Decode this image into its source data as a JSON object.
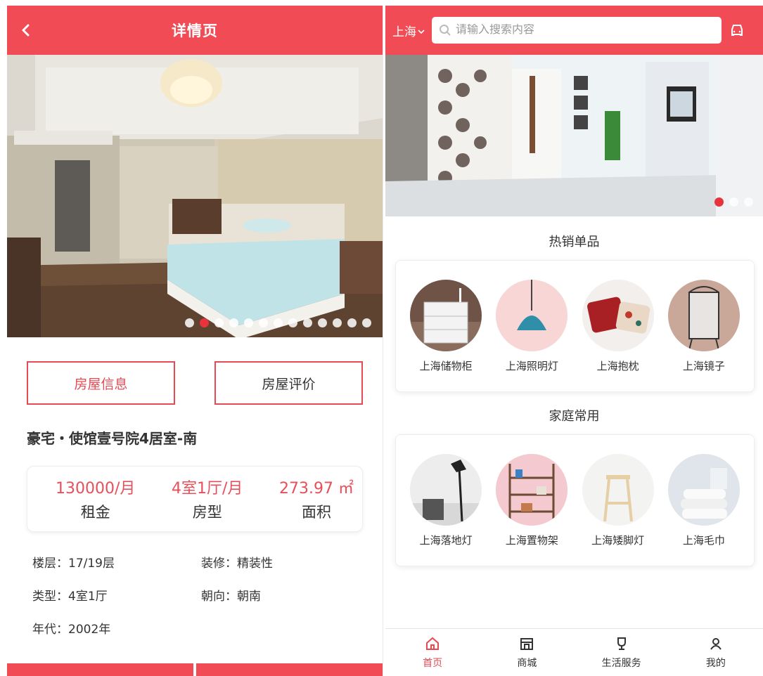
{
  "detail": {
    "header": {
      "title": "详情页"
    },
    "photo": {
      "dot_count": 13,
      "active_dot": 1
    },
    "tabs": [
      {
        "label": "房屋信息",
        "active": true
      },
      {
        "label": "房屋评价",
        "active": false
      }
    ],
    "house_title": "豪宅・使馆壹号院4居室-南",
    "stats": [
      {
        "value": "130000/月",
        "label": "租金"
      },
      {
        "value": "4室1厅/月",
        "label": "房型"
      },
      {
        "value": "273.97 ㎡",
        "label": "面积"
      }
    ],
    "specs": [
      {
        "text": "楼层：17/19层"
      },
      {
        "text": "装修：精装性"
      },
      {
        "text": "类型：4室1厅"
      },
      {
        "text": "朝向：朝南"
      },
      {
        "text": "年代：2002年"
      }
    ]
  },
  "home": {
    "header": {
      "city": "上海",
      "search_placeholder": "请输入搜索内容"
    },
    "banner": {
      "dot_count": 3,
      "active_dot": 0
    },
    "sections": [
      {
        "title": "热销单品",
        "items": [
          {
            "name": "上海储物柜",
            "icon": "dresser-image"
          },
          {
            "name": "上海照明灯",
            "icon": "pendant-lamp-image"
          },
          {
            "name": "上海抱枕",
            "icon": "pillow-image"
          },
          {
            "name": "上海镜子",
            "icon": "mirror-image"
          }
        ]
      },
      {
        "title": "家庭常用",
        "items": [
          {
            "name": "上海落地灯",
            "icon": "floor-lamp-image"
          },
          {
            "name": "上海置物架",
            "icon": "shelf-image"
          },
          {
            "name": "上海矮脚灯",
            "icon": "stool-image"
          },
          {
            "name": "上海毛巾",
            "icon": "towel-image"
          }
        ]
      }
    ],
    "tabbar": [
      {
        "label": "首页",
        "icon": "home-icon",
        "active": true
      },
      {
        "label": "商城",
        "icon": "shop-icon",
        "active": false
      },
      {
        "label": "生活服务",
        "icon": "trophy-icon",
        "active": false
      },
      {
        "label": "我的",
        "icon": "user-icon",
        "active": false
      }
    ]
  },
  "colors": {
    "brand": "#f14b55",
    "accent_text": "#e6505a",
    "active_dot": "#e8323c"
  }
}
